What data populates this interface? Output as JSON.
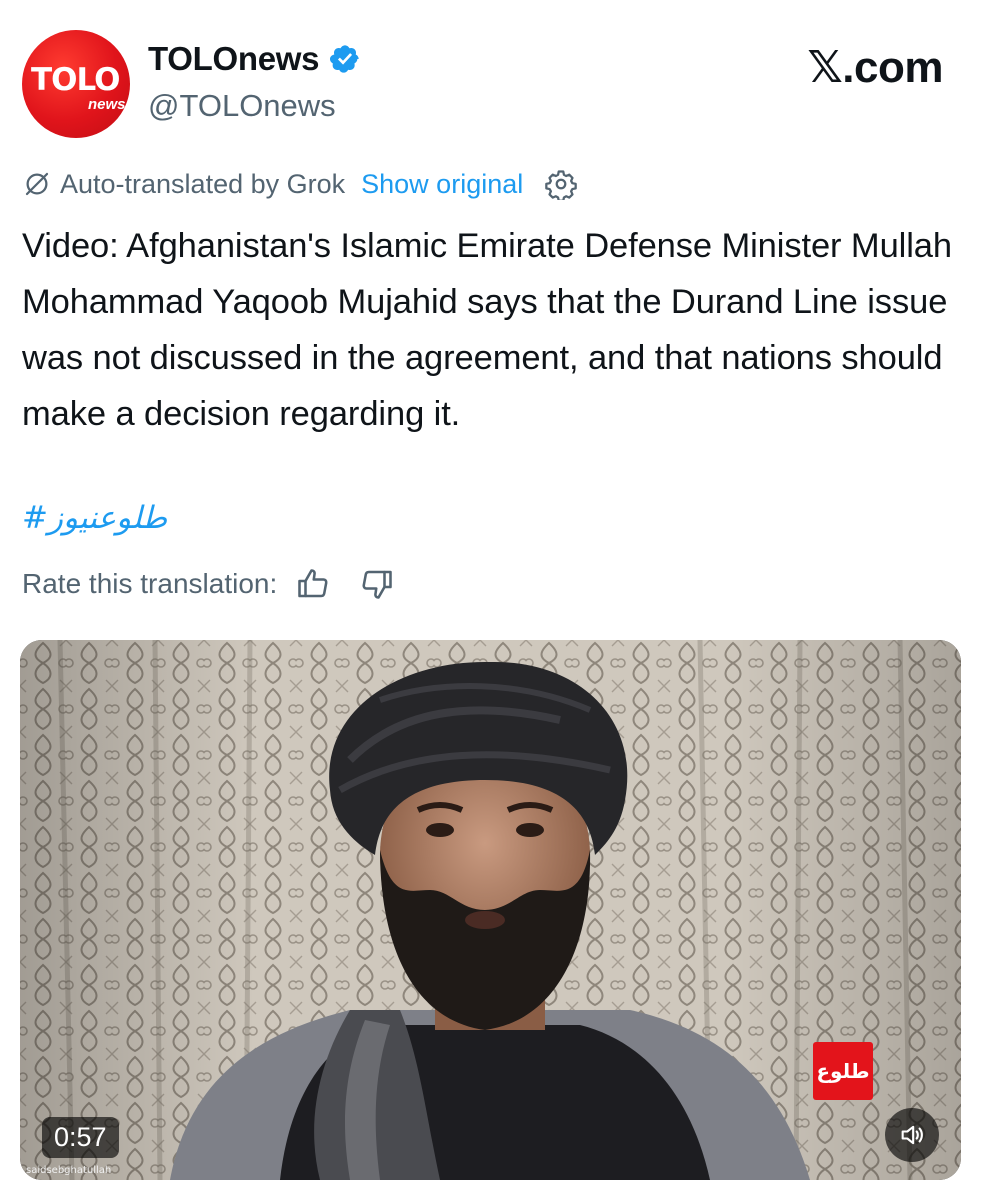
{
  "account": {
    "logo_text": "TOLO",
    "logo_sub": "news",
    "display_name": "TOLOnews",
    "handle": "@TOLOnews",
    "verified": true
  },
  "brand": "𝕏.com",
  "translation": {
    "notice": "Auto-translated by Grok",
    "show_original": "Show original"
  },
  "tweet": {
    "text": "Video: Afghanistan's Islamic Emirate Defense Minister Mullah Mohammad Yaqoob Mujahid says that the Durand Line issue was not discussed in the agreement, and that nations should make a decision regarding it.",
    "hashtag": "#طلوعنیوز"
  },
  "rating": {
    "label": "Rate this translation:"
  },
  "video": {
    "duration": "0:57",
    "channel_bug": "طلوع",
    "credit": "saidsebghatullah"
  },
  "colors": {
    "accent": "#1d9bf0",
    "secondary_text": "#536471",
    "logo_red": "#e0141b"
  }
}
